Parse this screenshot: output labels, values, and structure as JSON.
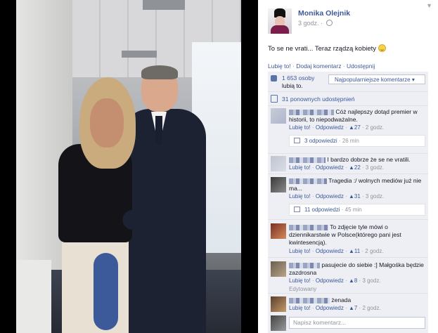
{
  "post": {
    "author": "Monika Olejnik",
    "time": "3 godz.",
    "text": "To se ne vrati... Teraz rządzą kobiety",
    "actions": {
      "like": "Lubię to!",
      "comment": "Dodaj komentarz",
      "share": "Udostępnij"
    },
    "likes_count": "1 653 osoby",
    "likes_suffix": "lubią to.",
    "sort_label": "Najpopularniejsze komentarze",
    "shares": "31 ponownych udostępnień"
  },
  "comments": [
    {
      "text": "Cóż najlepszy dotąd premier w historii, to niepodważalne.",
      "like": "Lubię to!",
      "reply": "Odpowiedz",
      "likes": "27",
      "time": "2 godz.",
      "replies": "3 odpowiedzi",
      "replies_time": "26 min"
    },
    {
      "text": "I bardzo dobrze że se ne vratili.",
      "like": "Lubię to!",
      "reply": "Odpowiedz",
      "likes": "22",
      "time": "3 godz."
    },
    {
      "text": "Tragedia :/ wolnych mediów już nie ma...",
      "like": "Lubię to!",
      "reply": "Odpowiedz",
      "likes": "31",
      "time": "3 godz.",
      "replies": "11 odpowiedzi",
      "replies_time": "45 min"
    },
    {
      "text": "To zdjęcie tyle mówi o dziennikarstwie w Polsce(którego pani jest kwintesencją).",
      "like": "Lubię to!",
      "reply": "Odpowiedz",
      "likes": "11",
      "time": "2 godz."
    },
    {
      "text": "pasujecie do siebie :] Małgośka będzie zazdrosna",
      "like": "Lubię to!",
      "reply": "Odpowiedz",
      "likes": "8",
      "time": "3 godz.",
      "edited": "Edytowany"
    },
    {
      "text": "żenada",
      "like": "Lubię to!",
      "reply": "Odpowiedz",
      "likes": "7",
      "time": "2 godz."
    }
  ],
  "composer": {
    "placeholder": "Napisz komentarz..."
  },
  "colors": {
    "link": "#3b5998",
    "feedback_bg": "#edeff4",
    "muted": "#90949c"
  },
  "icons": [
    "chevron-down-icon",
    "globe-icon",
    "smiley-icon",
    "thumb-up-icon",
    "share-icon",
    "reply-icon"
  ]
}
